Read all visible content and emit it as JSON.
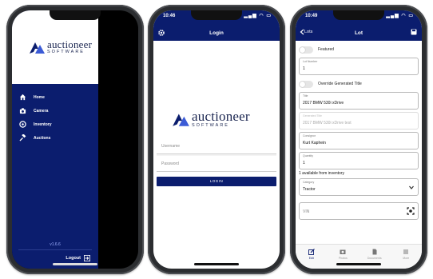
{
  "brand": {
    "name": "auctioneer",
    "tagline": "SOFTWARE",
    "navy": "#0b1d6e",
    "accent": "#3b5bd6"
  },
  "drawer_screen": {
    "menu": [
      {
        "label": "Home",
        "icon": "home-icon"
      },
      {
        "label": "Camera",
        "icon": "camera-icon"
      },
      {
        "label": "Inventory",
        "icon": "inventory-icon"
      },
      {
        "label": "Auctions",
        "icon": "gavel-icon"
      }
    ],
    "version": "v1.6.6",
    "logout_label": "Logout"
  },
  "login_screen": {
    "time": "10:46",
    "title": "Login",
    "username_placeholder": "Username",
    "password_placeholder": "Password",
    "login_label": "LOGIN"
  },
  "lot_screen": {
    "time": "10:49",
    "back_label": "Lots",
    "title": "Lot",
    "featured_label": "Featured",
    "lot_number_label": "Lot Number",
    "lot_number_value": "1",
    "override_label": "Override Generated Title",
    "title_label": "Title",
    "title_value": "2017 BMW 530i xDrive",
    "generated_title_label": "Generated Title",
    "generated_title_value": "2017 BMW 530i xDrive test",
    "consignor_label": "Consignor",
    "consignor_value": "Kurt Kaphein",
    "quantity_label": "Quantity",
    "quantity_value": "1",
    "available_text": "1 available from inventory",
    "category_label": "Category",
    "category_value": "Tractor",
    "vin_placeholder": "VIN",
    "tabs": [
      {
        "label": "Edit",
        "icon": "edit-icon"
      },
      {
        "label": "Photos",
        "icon": "photos-icon"
      },
      {
        "label": "Documents",
        "icon": "documents-icon"
      },
      {
        "label": "More",
        "icon": "more-icon"
      }
    ]
  }
}
